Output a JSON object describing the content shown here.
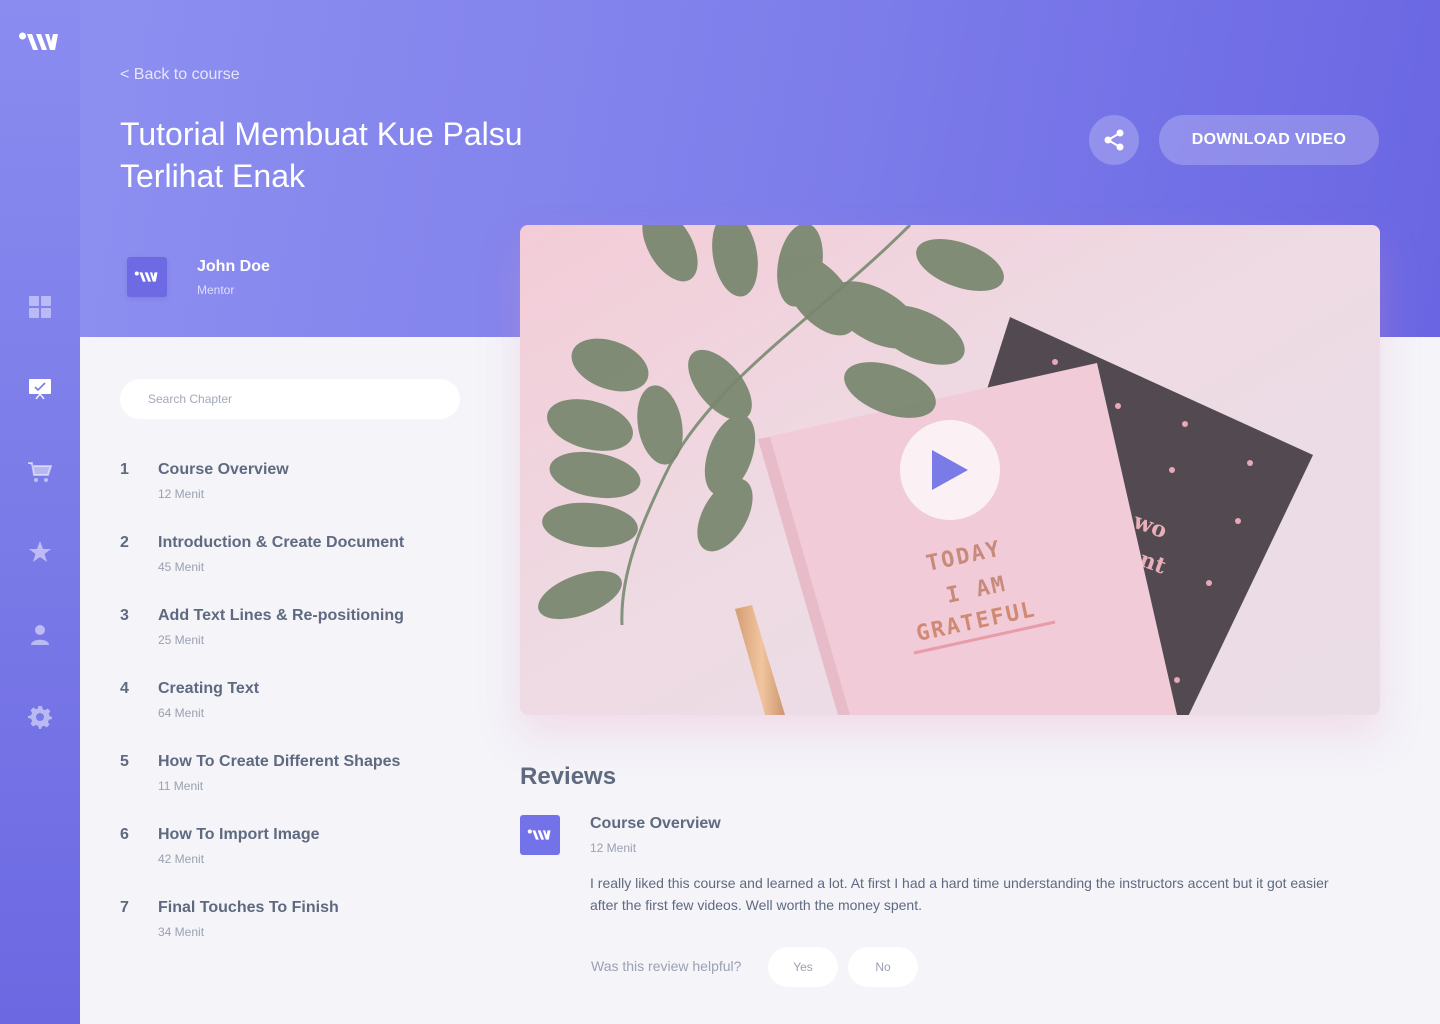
{
  "app": {
    "logo_icon": "brand-logo-icon"
  },
  "colors": {
    "accent": "#7b7be8",
    "accent_dark": "#6a66e3",
    "text": "#5f6a80",
    "muted": "#9aa1b1",
    "background": "#f4f4f9"
  },
  "sidebar": {
    "items": [
      {
        "name": "dashboard",
        "icon": "grid-icon"
      },
      {
        "name": "courses",
        "icon": "presentation-icon",
        "active": true
      },
      {
        "name": "cart",
        "icon": "cart-icon"
      },
      {
        "name": "favorites",
        "icon": "star-icon"
      },
      {
        "name": "profile",
        "icon": "user-icon"
      },
      {
        "name": "settings",
        "icon": "gear-icon"
      }
    ]
  },
  "header": {
    "back_label": "< Back to course",
    "title": "Tutorial Membuat Kue Palsu Terlihat Enak",
    "share_icon": "share-icon",
    "download_label": "DOWNLOAD VIDEO"
  },
  "mentor": {
    "name": "John Doe",
    "role": "Mentor"
  },
  "search": {
    "placeholder": "Search Chapter"
  },
  "chapters": [
    {
      "num": "1",
      "title": "Course Overview",
      "duration": "12 Menit"
    },
    {
      "num": "2",
      "title": "Introduction & Create Document",
      "duration": "45  Menit"
    },
    {
      "num": "3",
      "title": "Add Text Lines & Re-positioning",
      "duration": "25 Menit"
    },
    {
      "num": "4",
      "title": "Creating Text",
      "duration": "64 Menit"
    },
    {
      "num": "5",
      "title": "How To Create Different Shapes",
      "duration": "11 Menit"
    },
    {
      "num": "6",
      "title": "How To Import Image",
      "duration": "42 Menit"
    },
    {
      "num": "7",
      "title": "Final Touches To Finish",
      "duration": "34 Menit"
    }
  ],
  "video": {
    "play_icon": "play-icon",
    "book_text": [
      "TODAY",
      "I AM",
      "GRATEFUL"
    ]
  },
  "reviews": {
    "heading": "Reviews",
    "items": [
      {
        "title": "Course Overview",
        "meta": "12 Menit",
        "body": "I really liked this course and learned a lot. At first I had a hard time understanding the instructors accent but it got easier after the first few videos. Well worth the money spent.",
        "helpful_prompt": "Was this review helpful?",
        "yes_label": "Yes",
        "no_label": "No"
      }
    ]
  }
}
